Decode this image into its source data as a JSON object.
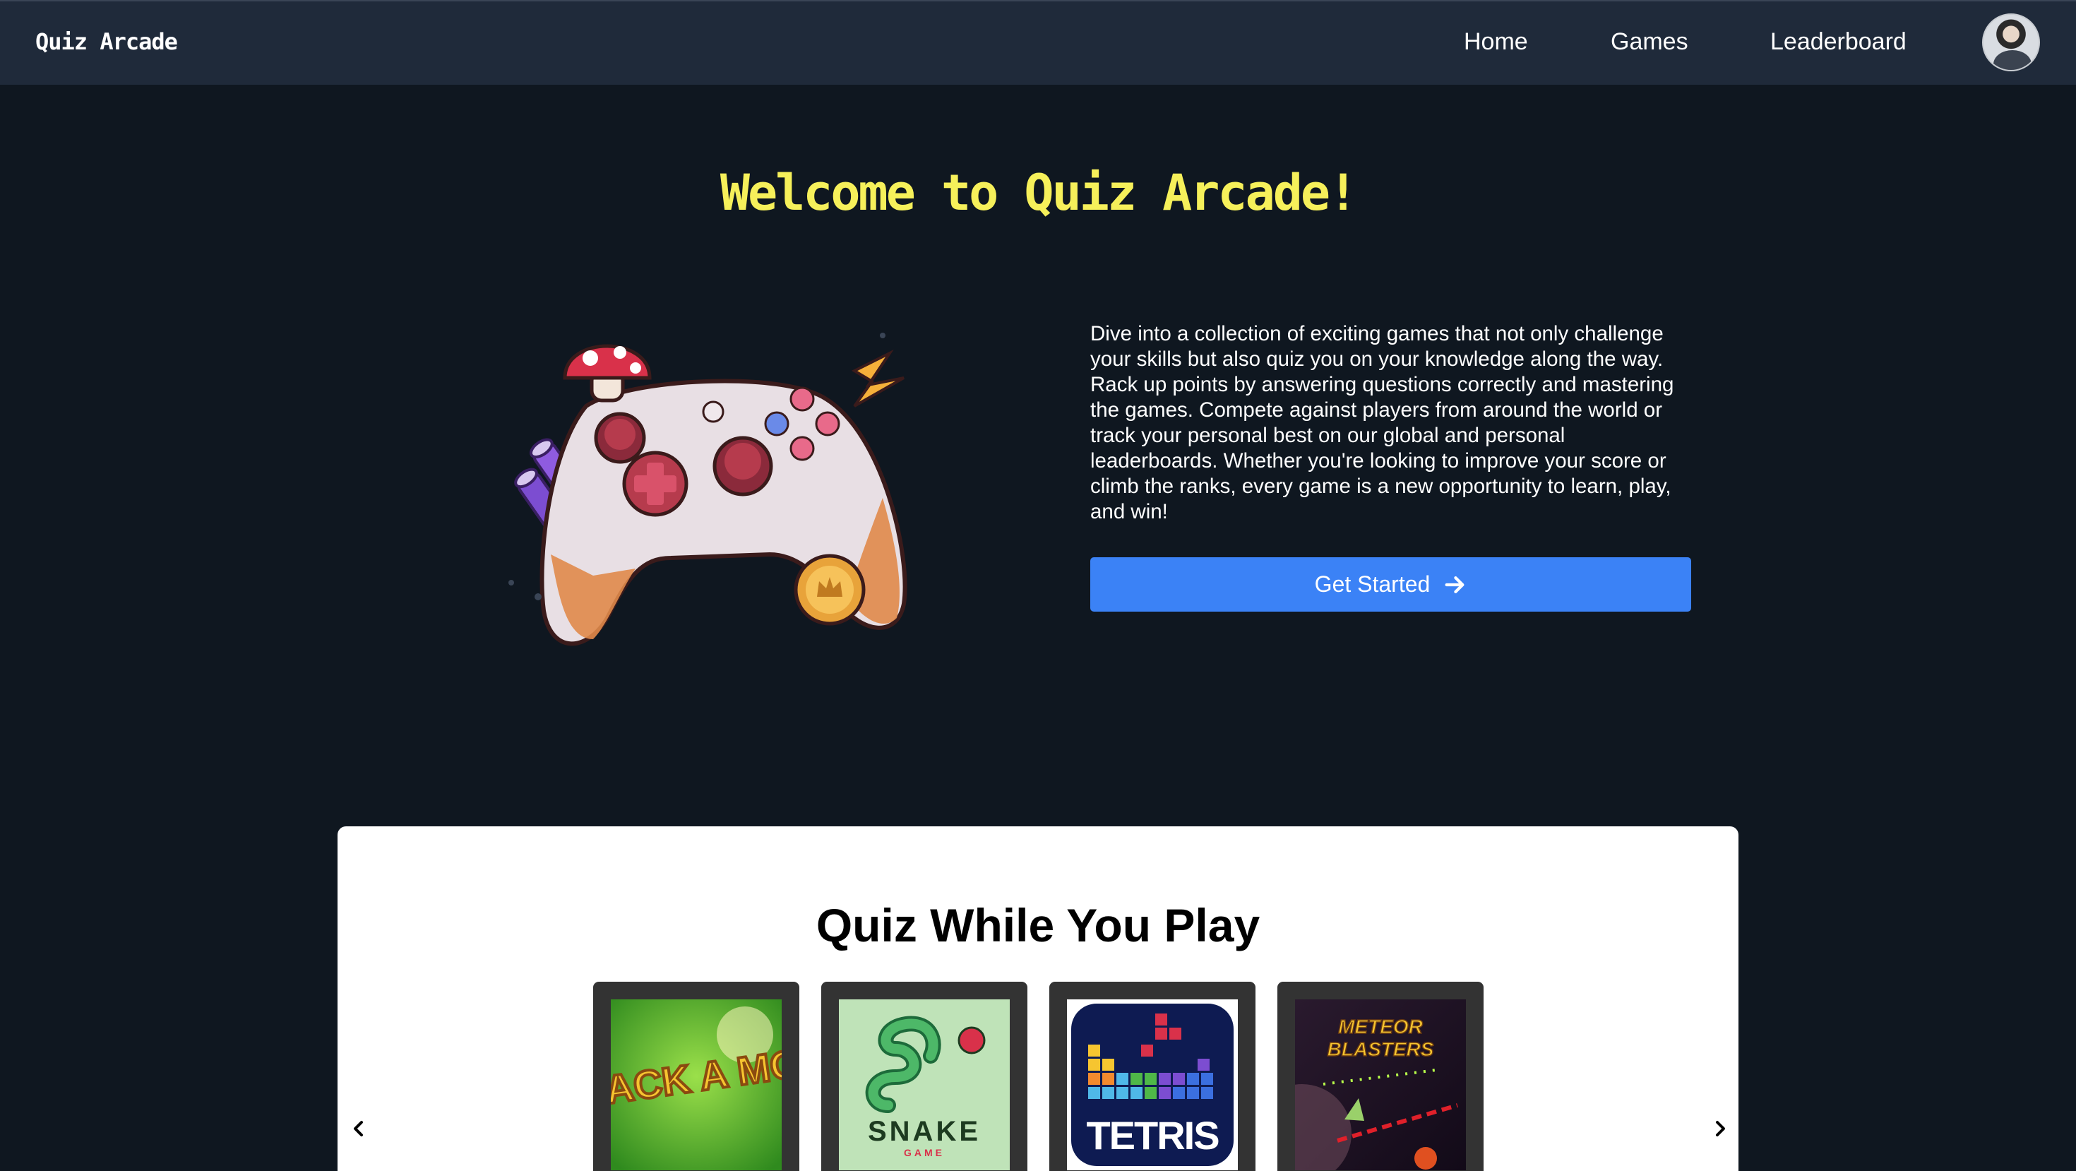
{
  "nav": {
    "brand": "Quiz Arcade",
    "links": [
      "Home",
      "Games",
      "Leaderboard"
    ]
  },
  "hero": {
    "title": "Welcome to Quiz Arcade!",
    "description": "Dive into a collection of exciting games that not only challenge your skills but also quiz you on your knowledge along the way. Rack up points by answering questions correctly and mastering the games. Compete against players from around the world or track your personal best on our global and personal leaderboards. Whether you're looking to improve your score or climb the ranks, every game is a new opportunity to learn, play, and win!",
    "cta_label": "Get Started"
  },
  "games_section": {
    "title": "Quiz While You Play",
    "prev_icon": "chevron-left-icon",
    "next_icon": "chevron-right-icon",
    "games": [
      {
        "title": "WHACK A MOLE"
      },
      {
        "title": "SNAKE",
        "subtitle": "GAME"
      },
      {
        "title": "TETRIS"
      },
      {
        "title": "METEOR BLASTERS"
      }
    ]
  },
  "colors": {
    "page_bg": "#0f1720",
    "nav_bg": "#1f2a3a",
    "accent_yellow": "#f6f05a",
    "button_blue": "#3b82f6"
  }
}
